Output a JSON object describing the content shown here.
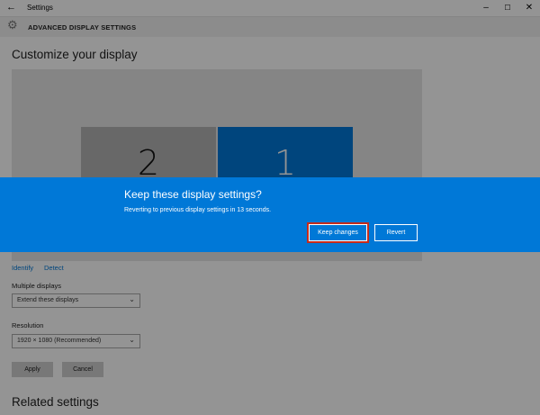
{
  "window": {
    "title": "Settings",
    "back_glyph": "←",
    "minimize_glyph": "–",
    "maximize_glyph": "☐",
    "close_glyph": "✕"
  },
  "header": {
    "icon": "gear-icon",
    "title": "ADVANCED DISPLAY SETTINGS"
  },
  "page": {
    "title": "Customize your display",
    "monitors": [
      {
        "number": "2",
        "color": "#b4b4b4"
      },
      {
        "number": "1",
        "color": "#0078d7"
      }
    ],
    "identify_label": "Identify",
    "detect_label": "Detect",
    "multiple_displays_label": "Multiple displays",
    "multiple_displays_value": "Extend these displays",
    "resolution_label": "Resolution",
    "resolution_value": "1920 × 1080 (Recommended)",
    "apply_label": "Apply",
    "cancel_label": "Cancel",
    "related_title": "Related settings"
  },
  "dialog": {
    "title": "Keep these display settings?",
    "message": "Reverting to previous display settings in 13 seconds.",
    "keep_label": "Keep changes",
    "revert_label": "Revert",
    "accent_color": "#0078d7",
    "focus_color": "#c42b1c"
  }
}
